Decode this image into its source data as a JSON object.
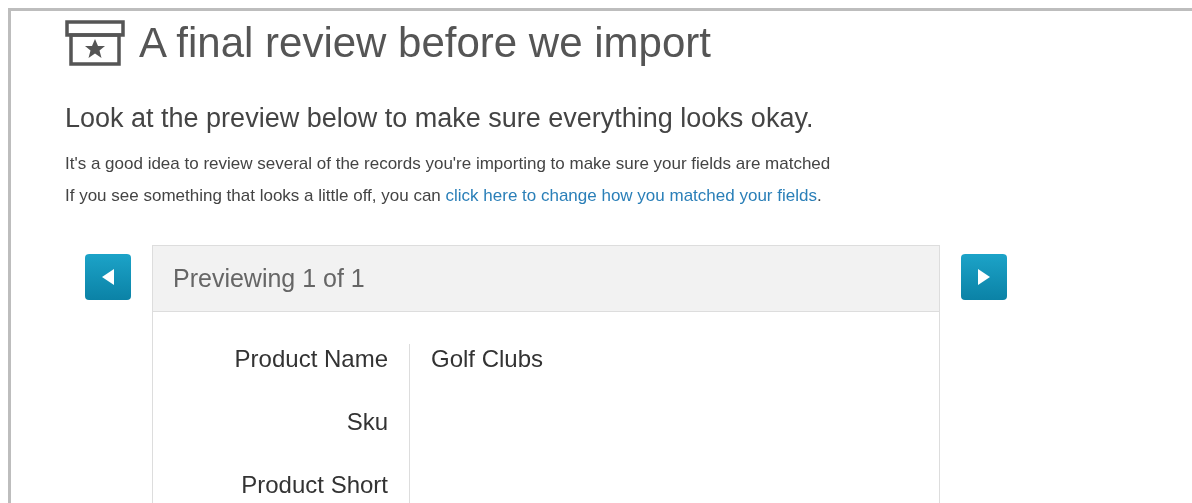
{
  "title": "A final review before we import",
  "subtitle": "Look at the preview below to make sure everything looks okay.",
  "intro": {
    "line_1": "It's a good idea to review several of the records you're importing to make sure your fields are matched",
    "line_2": "If you see something that looks a little off, you can",
    "link": "click here to change how you matched your fields",
    "after_link": "."
  },
  "preview": {
    "header": "Previewing 1 of 1",
    "fields": [
      {
        "label": "Product Name",
        "value": "Golf Clubs"
      },
      {
        "label": "Sku"
      },
      {
        "label": "Product Short"
      }
    ]
  }
}
